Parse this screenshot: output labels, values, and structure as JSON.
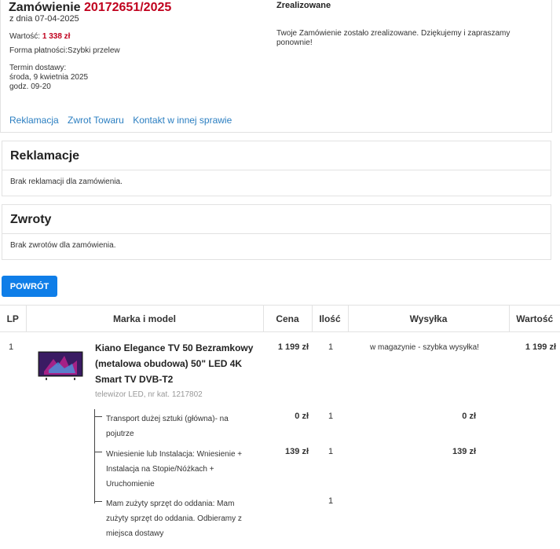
{
  "order": {
    "title_prefix": "Zamówienie ",
    "number": "20172651/2025",
    "date": "z dnia 07-04-2025",
    "value_label": "Wartość: ",
    "value_amount": "1 338 zł",
    "payment": "Forma płatności:Szybki przelew",
    "delivery_label": "Termin dostawy:",
    "delivery_date": "środa, 9 kwietnia 2025",
    "delivery_hours": "godz. 09-20",
    "status_title": "Zrealizowane",
    "status_text": "Twoje Zamówienie zostało zrealizowane. Dziękujemy i zapraszamy ponownie!",
    "links": [
      "Reklamacja",
      "Zwrot Towaru",
      "Kontakt w innej sprawie"
    ]
  },
  "complaints": {
    "title": "Reklamacje",
    "text": "Brak reklamacji dla zamówienia."
  },
  "returns": {
    "title": "Zwroty",
    "text": "Brak zwrotów dla zamówienia."
  },
  "back_button": "POWRÓT",
  "table": {
    "headers": [
      "LP",
      "Marka i model",
      "Cena",
      "Ilość",
      "Wysyłka",
      "Wartość"
    ],
    "product": {
      "lp": "1",
      "name": "Kiano Elegance TV 50 Bezramkowy (metalowa obudowa) 50\" LED 4K Smart TV DVB-T2",
      "subtitle": "telewizor LED, nr kat. 1217802",
      "price": "1 199 zł",
      "qty": "1",
      "shipping": "w magazynie - szybka wysyłka!",
      "total": "1 199 zł"
    },
    "services": [
      {
        "name": "Transport dużej sztuki (główna)- na pojutrze",
        "price": "0 zł",
        "qty": "1",
        "total": "0 zł"
      },
      {
        "name": "Wniesienie lub Instalacja: Wniesienie + Instalacja na Stopie/Nóżkach + Uruchomienie",
        "price": "139 zł",
        "qty": "1",
        "total": "139 zł"
      },
      {
        "name": "Mam zużyty sprzęt do oddania: Mam zużyty sprzęt do oddania. Odbieramy z miejsca dostawy",
        "price": "",
        "qty": "1",
        "total": ""
      }
    ]
  },
  "icons": {
    "product_image": "tv-image-icon"
  },
  "colors": {
    "accent_red": "#c0001d",
    "link_blue": "#2a7ec1",
    "button_blue": "#0f7ee8"
  }
}
